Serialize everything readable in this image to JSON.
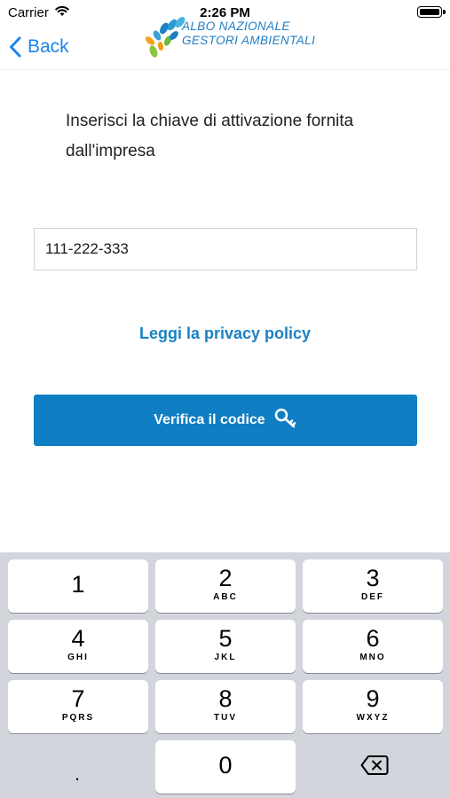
{
  "status_bar": {
    "carrier": "Carrier",
    "time": "2:26 PM"
  },
  "nav": {
    "back_label": "Back",
    "logo_line1": "ALBO NAZIONALE",
    "logo_line2": "GESTORI AMBIENTALI"
  },
  "content": {
    "instruction": "Inserisci la chiave di attivazione fornita dall'impresa",
    "input_value": "111-222-333",
    "privacy_link": "Leggi la privacy policy",
    "verify_label": "Verifica il codice"
  },
  "keyboard": {
    "keys": [
      {
        "digit": "1",
        "letters": ""
      },
      {
        "digit": "2",
        "letters": "ABC"
      },
      {
        "digit": "3",
        "letters": "DEF"
      },
      {
        "digit": "4",
        "letters": "GHI"
      },
      {
        "digit": "5",
        "letters": "JKL"
      },
      {
        "digit": "6",
        "letters": "MNO"
      },
      {
        "digit": "7",
        "letters": "PQRS"
      },
      {
        "digit": "8",
        "letters": "TUV"
      },
      {
        "digit": "9",
        "letters": "WXYZ"
      },
      {
        "digit": "0",
        "letters": ""
      }
    ],
    "dot": "."
  },
  "colors": {
    "accent_blue": "#0f7ec3",
    "link_blue": "#1b82c4",
    "ios_blue": "#1e86e8",
    "keyboard_bg": "#d2d5db"
  },
  "icons": {
    "back": "chevron-left-icon",
    "verify": "key-icon",
    "delete": "backspace-icon"
  }
}
